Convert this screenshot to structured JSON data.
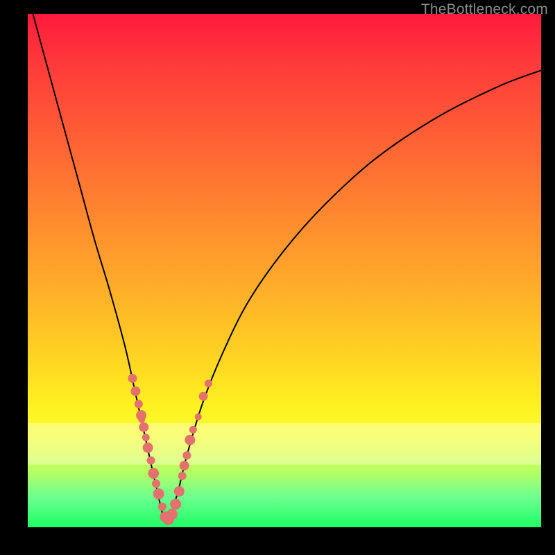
{
  "watermark": "TheBottleneck.com",
  "colors": {
    "curve": "#000000",
    "marker": "#e5716f",
    "frame_bg_top": "#ff1a3c",
    "frame_bg_bottom": "#1eff66",
    "page_bg": "#000000"
  },
  "chart_data": {
    "type": "line",
    "title": "",
    "xlabel": "",
    "ylabel": "",
    "xlim": [
      0,
      100
    ],
    "ylim": [
      0,
      100
    ],
    "note": "V-shaped bottleneck curve; minimum reaches y≈0 near x≈27. Axes have no visible tick labels — x/y values are read off the plot-area position (0–100 each).",
    "series": [
      {
        "name": "curve",
        "x": [
          1,
          4,
          7,
          10,
          13,
          16,
          19,
          21,
          23,
          25,
          27,
          29,
          31,
          34,
          38,
          43,
          50,
          58,
          68,
          80,
          92,
          100
        ],
        "y": [
          100,
          89,
          78,
          67,
          56,
          46,
          35,
          26,
          17,
          8,
          1,
          6,
          14,
          24,
          34,
          44,
          54,
          63,
          72,
          80,
          86,
          89
        ]
      }
    ],
    "markers": {
      "name": "highlighted-points",
      "x": [
        20.4,
        21.0,
        21.6,
        22.1,
        22.2,
        22.6,
        23.0,
        23.4,
        24.0,
        24.5,
        25.0,
        25.5,
        26.2,
        26.8,
        27.4,
        28.1,
        28.8,
        29.5,
        30.1,
        30.5,
        31.0,
        31.6,
        32.2,
        33.2,
        34.2,
        35.2
      ],
      "y": [
        29.0,
        26.5,
        24.0,
        21.8,
        21.0,
        19.5,
        17.5,
        15.5,
        13.0,
        10.5,
        8.5,
        6.5,
        4.0,
        2.0,
        1.5,
        2.5,
        4.5,
        7.0,
        10.0,
        12.0,
        14.0,
        17.0,
        19.0,
        21.5,
        25.5,
        28.0
      ],
      "r": [
        6.5,
        7.0,
        6.0,
        7.5,
        5.0,
        7.0,
        5.5,
        7.5,
        6.0,
        7.8,
        6.0,
        8.0,
        6.0,
        8.0,
        8.0,
        8.0,
        8.0,
        7.5,
        6.0,
        7.0,
        6.0,
        7.5,
        5.5,
        5.0,
        6.5,
        5.5
      ]
    }
  }
}
